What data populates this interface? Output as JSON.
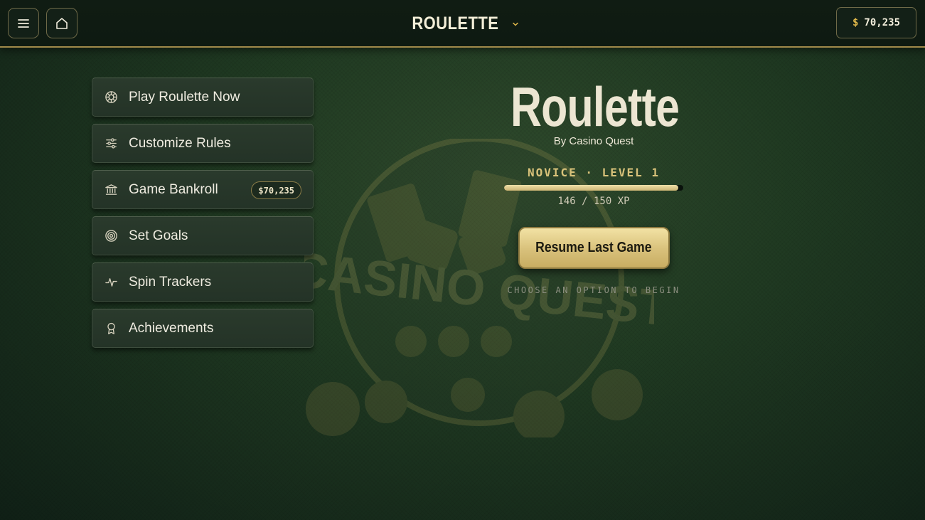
{
  "topbar": {
    "menu_icon": "hamburger-menu-icon",
    "home_icon": "home-icon",
    "title": "ROULETTE",
    "title_dropdown_icon": "chevron-down-icon",
    "balance_currency": "$",
    "balance_amount": "70,235"
  },
  "sidebar": {
    "items": [
      {
        "label": "Play Roulette Now",
        "icon": "roulette-wheel-icon"
      },
      {
        "label": "Customize Rules",
        "icon": "sliders-icon"
      },
      {
        "label": "Game Bankroll",
        "icon": "bank-icon",
        "badge": "$70,235"
      },
      {
        "label": "Set Goals",
        "icon": "target-icon"
      },
      {
        "label": "Spin Trackers",
        "icon": "activity-icon"
      },
      {
        "label": "Achievements",
        "icon": "award-icon"
      }
    ]
  },
  "hero": {
    "title": "Roulette",
    "byline": "By Casino Quest",
    "level_label": "NOVICE · LEVEL 1",
    "xp_current": 146,
    "xp_max": 150,
    "xp_text": "146 / 150 XP",
    "resume_label": "Resume Last Game",
    "hint": "CHOOSE AN OPTION TO BEGIN"
  },
  "background": {
    "watermark_text": "CASINO QUEST"
  },
  "colors": {
    "accent_gold": "#d8c27a",
    "background_green": "#203a22",
    "currency_gold": "#e0b84a"
  }
}
